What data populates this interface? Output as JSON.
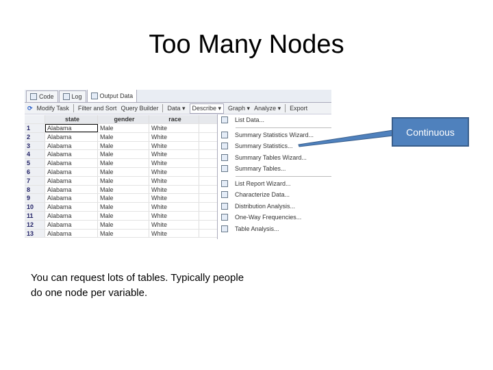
{
  "title": "Too Many Nodes",
  "tabs": [
    "Code",
    "Log",
    "Output Data"
  ],
  "toolbar": [
    "Modify Task",
    "Filter and Sort",
    "Query Builder",
    "Data ▾",
    "Describe ▾",
    "Graph ▾",
    "Analyze ▾",
    "Export"
  ],
  "columns": [
    "state",
    "gender",
    "race"
  ],
  "rows": [
    [
      "1",
      "Alabama",
      "Male",
      "White"
    ],
    [
      "2",
      "Alabama",
      "Male",
      "White"
    ],
    [
      "3",
      "Alabama",
      "Male",
      "White"
    ],
    [
      "4",
      "Alabama",
      "Male",
      "White"
    ],
    [
      "5",
      "Alabama",
      "Male",
      "White"
    ],
    [
      "6",
      "Alabama",
      "Male",
      "White"
    ],
    [
      "7",
      "Alabama",
      "Male",
      "White"
    ],
    [
      "8",
      "Alabama",
      "Male",
      "White"
    ],
    [
      "9",
      "Alabama",
      "Male",
      "White"
    ],
    [
      "10",
      "Alabama",
      "Male",
      "White"
    ],
    [
      "11",
      "Alabama",
      "Male",
      "White"
    ],
    [
      "12",
      "Alabama",
      "Male",
      "White"
    ],
    [
      "13",
      "Alabama",
      "Male",
      "White"
    ]
  ],
  "menu": {
    "g1": [
      "List Data..."
    ],
    "g2": [
      "Summary Statistics Wizard...",
      "Summary Statistics...",
      "Summary Tables Wizard...",
      "Summary Tables..."
    ],
    "g3": [
      "List Report Wizard...",
      "Characterize Data...",
      "Distribution Analysis...",
      "One-Way Frequencies...",
      "Table Analysis..."
    ]
  },
  "callout": "Continuous",
  "body": [
    "You can request lots of tables. Typically people",
    "do one node per variable."
  ]
}
